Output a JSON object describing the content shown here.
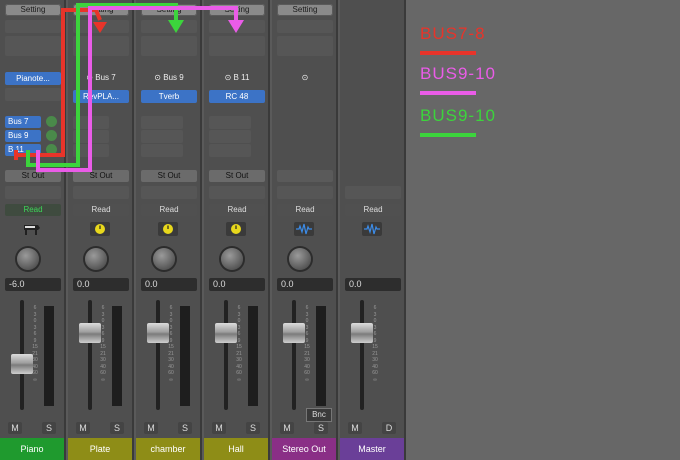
{
  "strips": [
    {
      "id": "piano",
      "setting": "Setting",
      "channel": "Pianote...",
      "sends": [
        "Bus 7",
        "Bus 9",
        "B 11"
      ],
      "output": "St Out",
      "automation": "Read",
      "volume": "-6.0",
      "mute": "M",
      "solo": "S",
      "name": "Piano",
      "name_color": "#1f9a2e",
      "fader_level": 0.4
    },
    {
      "id": "plate",
      "setting": "Setting",
      "channel": "Bus 7",
      "plugin": "RevPLA...",
      "output": "St Out",
      "automation": "Read",
      "volume": "0.0",
      "mute": "M",
      "solo": "S",
      "name": "Plate",
      "name_color": "#8e8d17",
      "fader_level": 0.75
    },
    {
      "id": "chamber",
      "setting": "Setting",
      "channel": "Bus 9",
      "plugin": "Tverb",
      "output": "St Out",
      "automation": "Read",
      "volume": "0.0",
      "mute": "M",
      "solo": "S",
      "name": "chamber",
      "name_color": "#8e8d17",
      "fader_level": 0.75
    },
    {
      "id": "hall",
      "setting": "Setting",
      "channel": "B 11",
      "plugin": "RC 48",
      "output": "St Out",
      "automation": "Read",
      "volume": "0.0",
      "mute": "M",
      "solo": "S",
      "name": "Hall",
      "name_color": "#8e8d17",
      "fader_level": 0.75
    },
    {
      "id": "stereo-out",
      "setting": "Setting",
      "channel": "",
      "output": "",
      "automation": "Read",
      "volume": "0.0",
      "mute": "M",
      "solo": "S",
      "bounce": "Bnc",
      "name": "Stereo Out",
      "name_color": "#8a2f86",
      "fader_level": 0.75
    },
    {
      "id": "master",
      "setting": "",
      "channel": "",
      "output": "",
      "automation": "Read",
      "volume": "0.0",
      "mute": "M",
      "solo": "D",
      "name": "Master",
      "name_color": "#6a3f98",
      "fader_level": 0.75
    }
  ],
  "legend": [
    {
      "label": "BUS7-8",
      "color": "#e8342a"
    },
    {
      "label": "BUS9-10",
      "color": "#ea5ce8"
    },
    {
      "label": "BUS9-10",
      "color": "#3cd43c"
    }
  ],
  "colors": {
    "route_red": "#e8342a",
    "route_magenta": "#ea5ce8",
    "route_green": "#3cd43c",
    "knob_yellow": "#e8d81c",
    "wave_blue": "#3c8ce8"
  },
  "icons": {
    "piano": "piano-icon",
    "clock": "clock-icon",
    "waveform": "waveform-icon",
    "link": "link-icon"
  }
}
